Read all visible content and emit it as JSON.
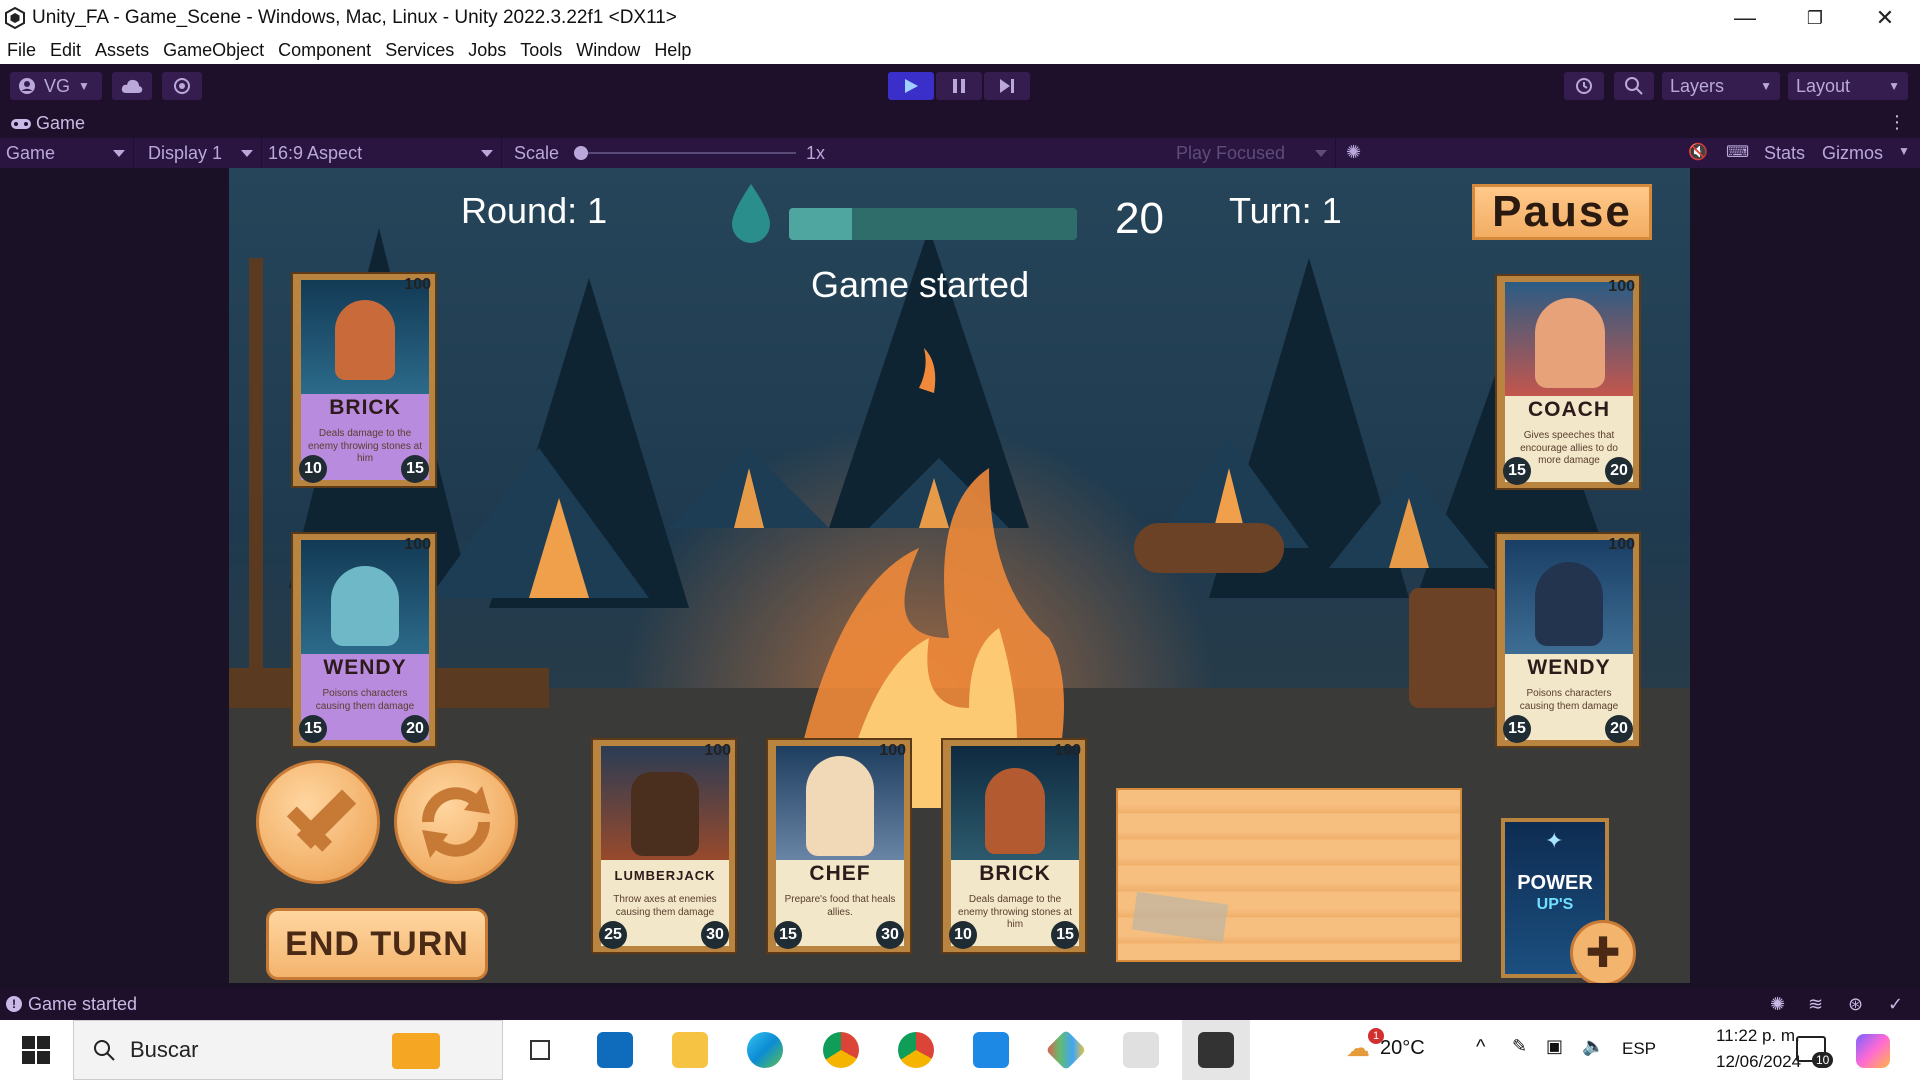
{
  "window": {
    "title": "Unity_FA - Game_Scene - Windows, Mac, Linux - Unity 2022.3.22f1 <DX11>"
  },
  "menu": [
    "File",
    "Edit",
    "Assets",
    "GameObject",
    "Component",
    "Services",
    "Jobs",
    "Tools",
    "Window",
    "Help"
  ],
  "toolbar": {
    "account": "VG",
    "layers": "Layers",
    "layout": "Layout"
  },
  "game_tab": {
    "title": "Game",
    "view_mode": "Game",
    "display": "Display 1",
    "aspect": "16:9 Aspect",
    "scale_label": "Scale",
    "scale_value": "1x",
    "play_mode": "Play Focused",
    "stats": "Stats",
    "gizmos": "Gizmos"
  },
  "hud": {
    "round": "Round: 1",
    "mana_value": "20",
    "mana_fill": 0.22,
    "turn": "Turn: 1",
    "pause": "Pause",
    "message": "Game started",
    "end_turn": "END TURN",
    "power_ups_line1": "POWER",
    "power_ups_line2": "UP'S"
  },
  "cards": {
    "enemy_brick": {
      "name": "BRICK",
      "hp": "100",
      "desc": "Deals damage to the enemy throwing stones at him",
      "left": "10",
      "right": "15"
    },
    "enemy_wendy": {
      "name": "WENDY",
      "hp": "100",
      "desc": "Poisons characters causing them damage",
      "left": "15",
      "right": "20"
    },
    "ally_coach": {
      "name": "COACH",
      "hp": "100",
      "desc": "Gives speeches that encourage allies to do more damage",
      "left": "15",
      "right": "20"
    },
    "ally_wendy": {
      "name": "WENDY",
      "hp": "100",
      "desc": "Poisons characters causing them damage",
      "left": "15",
      "right": "20"
    },
    "hand_lumberjack": {
      "name": "LUMBERJACK",
      "hp": "100",
      "desc": "Throw axes at enemies causing them damage",
      "left": "25",
      "right": "30"
    },
    "hand_chef": {
      "name": "CHEF",
      "hp": "100",
      "desc": "Prepare's food that heals allies.",
      "left": "15",
      "right": "30"
    },
    "hand_brick": {
      "name": "BRICK",
      "hp": "100",
      "desc": "Deals damage to the enemy throwing stones at him",
      "left": "10",
      "right": "15"
    }
  },
  "statusbar": {
    "message": "Game started"
  },
  "taskbar": {
    "search_placeholder": "Buscar",
    "weather": "20°C",
    "weather_badge": "1",
    "lang": "ESP",
    "time": "11:22 p. m.",
    "date": "12/06/2024",
    "notifications": "10"
  },
  "colors": {
    "unity_bg": "#1e0f2a",
    "accent_play": "#3b2fc9",
    "wood": "#f3b46e",
    "mana_bar": "#2f6d6a"
  }
}
